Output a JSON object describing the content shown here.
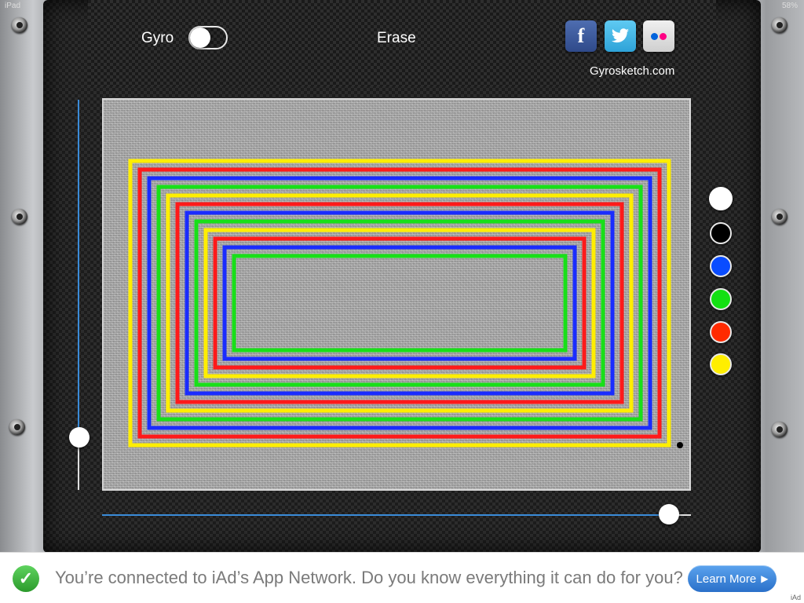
{
  "status": {
    "device": "iPad",
    "battery": "58%"
  },
  "toolbar": {
    "gyro_label": "Gyro",
    "gyro_on": false,
    "erase_label": "Erase",
    "website": "Gyrosketch.com"
  },
  "social": {
    "facebook_glyph": "f",
    "twitter_glyph": "t",
    "flickr_colors": [
      "#0063dc",
      "#ff0084"
    ]
  },
  "palette": {
    "colors": [
      "#ffffff",
      "#000000",
      "#0a4cff",
      "#13e012",
      "#ff2a00",
      "#ffee00"
    ],
    "names": [
      "white",
      "black",
      "blue",
      "green",
      "red",
      "yellow"
    ],
    "selected": "white"
  },
  "sliders": {
    "vertical_value": 0.13,
    "horizontal_value": 0.96
  },
  "drawing": {
    "line_colors": [
      "#ffee00",
      "#ff1a1a",
      "#1a2cff",
      "#18e018"
    ]
  },
  "ad": {
    "message": "You’re connected to iAd’s App Network. Do you know everything it can do for you?",
    "button_label": "Learn More",
    "tag": "iAd"
  },
  "colors": {
    "slider_track": "#3a8bd8",
    "ad_button": "#2a70c9"
  }
}
